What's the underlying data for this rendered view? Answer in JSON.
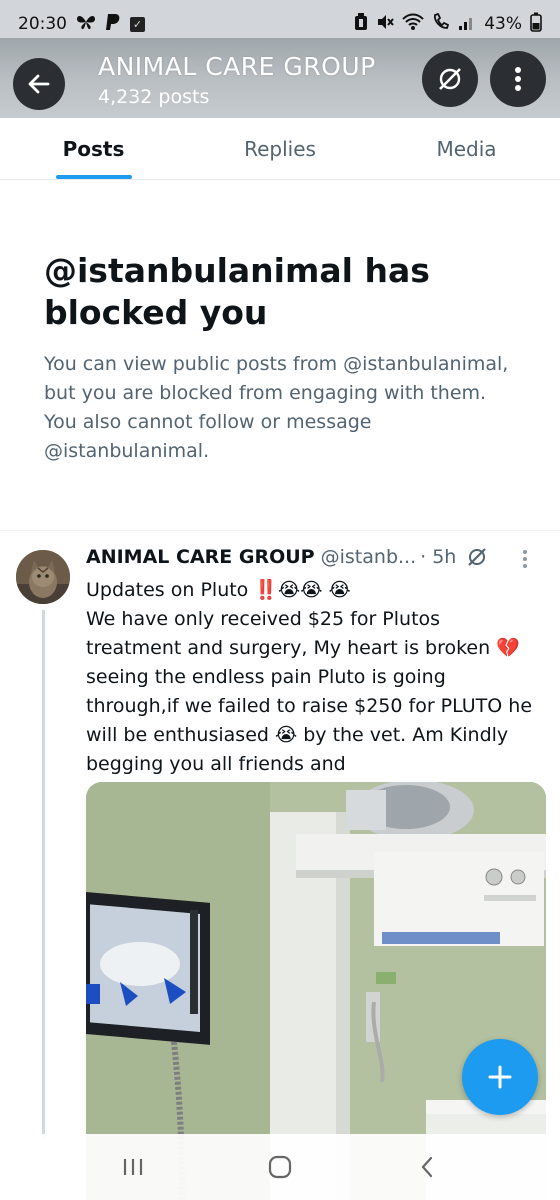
{
  "status_bar": {
    "time": "20:30",
    "battery": "43%",
    "icons": [
      "butterfly-icon",
      "paypal-icon",
      "check-box-icon",
      "battery-saver-icon",
      "mute-icon",
      "wifi-icon",
      "call-icon",
      "signal-icon",
      "battery-icon"
    ]
  },
  "header": {
    "title": "ANIMAL CARE GROUP",
    "posts_count": "4,232 posts"
  },
  "tabs": [
    {
      "label": "Posts",
      "active": true
    },
    {
      "label": "Replies",
      "active": false
    },
    {
      "label": "Media",
      "active": false
    }
  ],
  "blocked": {
    "title": "@istanbulanimal has blocked you",
    "body": "You can view public posts from @istanbulanimal, but you are blocked from engaging with them. You also cannot follow or message @istanbulanimal."
  },
  "post": {
    "name": "ANIMAL CARE GROUP",
    "handle": "@istanb...",
    "time": "· 5h",
    "lines": [
      "Updates on Pluto ‼️😭😭 😭",
      "We have only received $25 for Plutos treatment and surgery, My heart is broken 💔 seeing the endless pain Pluto is going through,if we failed to raise $250 for PLUTO he will be enthusiased 😭 by the vet. Am Kindly begging you all friends and"
    ]
  },
  "colors": {
    "accent": "#1d9bf0",
    "text_primary": "#0f1419",
    "text_secondary": "#536471"
  }
}
